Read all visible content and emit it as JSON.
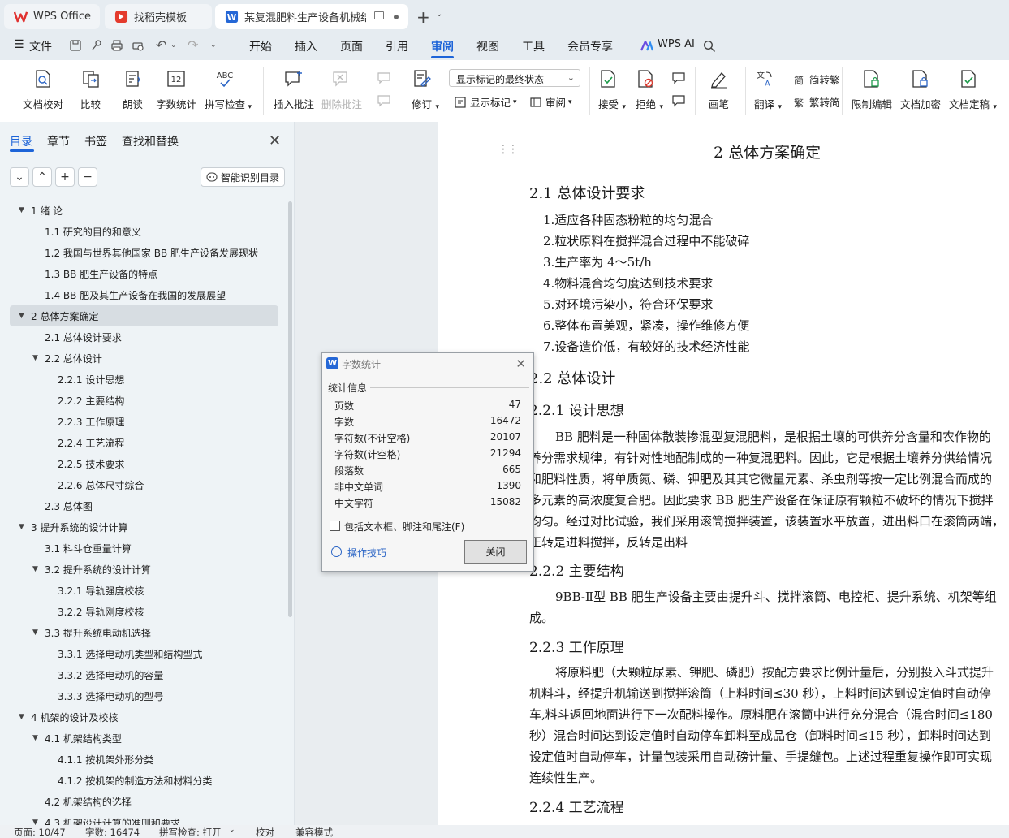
{
  "tabs": [
    {
      "label": "WPS Office",
      "icon": "wps-logo-icon"
    },
    {
      "label": "找稻壳模板",
      "icon": "docer-icon"
    },
    {
      "label": "某复混肥料生产设备机械结构设计",
      "icon": "word-doc-icon"
    }
  ],
  "menu": {
    "file": "文件",
    "items": [
      "开始",
      "插入",
      "页面",
      "引用",
      "审阅",
      "视图",
      "工具",
      "会员专享"
    ],
    "active": "审阅",
    "wps_ai": "WPS AI"
  },
  "ribbon": {
    "doc_proofread": "文档校对",
    "compare": "比较",
    "read_aloud": "朗读",
    "word_count": "字数统计",
    "spell_check": "拼写检查",
    "insert_comment": "插入批注",
    "delete_comment": "删除批注",
    "revise": "修订",
    "markup_dropdown": "显示标记的最终状态",
    "show_markup": "显示标记",
    "review": "审阅",
    "accept": "接受",
    "reject": "拒绝",
    "pen": "画笔",
    "translate": "翻译",
    "to_traditional": "简转繁",
    "to_simplified": "繁转简",
    "restrict_edit": "限制编辑",
    "encrypt": "文档加密",
    "finalize": "文档定稿"
  },
  "nav": {
    "tabs": [
      "目录",
      "章节",
      "书签",
      "查找和替换"
    ],
    "smart_toc": "智能识别目录",
    "toc": [
      {
        "level": 1,
        "text": "1  绪   论",
        "expanded": true
      },
      {
        "level": 2,
        "text": "1.1 研究的目的和意义"
      },
      {
        "level": 2,
        "text": "1.2  我国与世界其他国家 BB 肥生产设备发展现状"
      },
      {
        "level": 2,
        "text": "1.3 BB 肥生产设备的特点"
      },
      {
        "level": 2,
        "text": "1.4 BB 肥及其生产设备在我国的发展展望"
      },
      {
        "level": 1,
        "text": "2  总体方案确定",
        "expanded": true,
        "selected": true
      },
      {
        "level": 2,
        "text": "2.1  总体设计要求"
      },
      {
        "level": 2,
        "text": "2.2  总体设计",
        "expanded": true
      },
      {
        "level": 3,
        "text": "2.2.1  设计思想"
      },
      {
        "level": 3,
        "text": "2.2.2  主要结构"
      },
      {
        "level": 3,
        "text": "2.2.3  工作原理"
      },
      {
        "level": 3,
        "text": "2.2.4  工艺流程"
      },
      {
        "level": 3,
        "text": "2.2.5  技术要求"
      },
      {
        "level": 3,
        "text": "2.2.6  总体尺寸综合"
      },
      {
        "level": 2,
        "text": "2.3  总体图"
      },
      {
        "level": 1,
        "text": "3  提升系统的设计计算",
        "expanded": true
      },
      {
        "level": 2,
        "text": "3.1  料斗仓重量计算"
      },
      {
        "level": 2,
        "text": "3.2  提升系统的设计计算",
        "expanded": true
      },
      {
        "level": 3,
        "text": "3.2.1  导轨强度校核"
      },
      {
        "level": 3,
        "text": "3.2.2  导轨刚度校核"
      },
      {
        "level": 2,
        "text": "3.3  提升系统电动机选择",
        "expanded": true
      },
      {
        "level": 3,
        "text": "3.3.1    选择电动机类型和结构型式"
      },
      {
        "level": 3,
        "text": "3.3.2  选择电动机的容量"
      },
      {
        "level": 3,
        "text": "3.3.3 选择电动机的型号"
      },
      {
        "level": 1,
        "text": "4  机架的设计及校核",
        "expanded": true
      },
      {
        "level": 2,
        "text": "4.1 机架结构类型",
        "expanded": true
      },
      {
        "level": 3,
        "text": "4.1.1  按机架外形分类"
      },
      {
        "level": 3,
        "text": "4.1.2  按机架的制造方法和材料分类"
      },
      {
        "level": 2,
        "text": "4.2  机架结构的选择"
      },
      {
        "level": 2,
        "text": "4.3  机架设计计算的准则和要求",
        "expanded": true
      }
    ]
  },
  "doc": {
    "h1": "2  总体方案确定",
    "s21": "2.1  总体设计要求",
    "reqs": [
      "1.适应各种固态粉粒的均匀混合",
      "2.粒状原料在搅拌混合过程中不能破碎",
      "3.生产率为 4～5t/h",
      "4.物料混合均匀度达到技术要求",
      "5.对环境污染小，符合环保要求",
      "6.整体布置美观，紧凑，操作维修方便",
      "7.设备造价低，有较好的技术经济性能"
    ],
    "s22": "2.2  总体设计",
    "s221": "2.2.1  设计思想",
    "p221": [
      "BB 肥料是一种固体散装掺混型复混肥料，是根据土壤的可供养分含量和农作物的",
      "养分需求规律，有针对性地配制成的一种复混肥料。因此，它是根据土壤养分供给情况",
      "和肥料性质，将单质氮、磷、钾肥及其其它微量元素、杀虫剂等按一定比例混合而成的",
      "多元素的高浓度复合肥。因此要求 BB 肥生产设备在保证原有颗粒不破坏的情况下搅拌",
      "均匀。经过对比试验，我们采用滚筒搅拌装置，该装置水平放置，进出料口在滚筒两端，",
      "正转是进料搅拌，反转是出料"
    ],
    "s222": "2.2.2  主要结构",
    "p222": [
      "9BB-Ⅱ型 BB 肥生产设备主要由提升斗、搅拌滚筒、电控柜、提升系统、机架等组",
      "成。"
    ],
    "s223": "2.2.3  工作原理",
    "p223": [
      "将原料肥（大颗粒尿素、钾肥、磷肥）按配方要求比例计量后，分别投入斗式提升",
      "机料斗，经提升机输送到搅拌滚筒（上料时间≤30 秒），上料时间达到设定值时自动停",
      "车,料斗返回地面进行下一次配料操作。原料肥在滚筒中进行充分混合（混合时间≤180",
      "秒）混合时间达到设定值时自动停车卸料至成品仓（卸料时间≤15 秒），卸料时间达到",
      "设定值时自动停车，计量包装采用自动磅计量、手提缝包。上述过程重复操作即可实现",
      "连续性生产。"
    ],
    "s224": "2.2.4  工艺流程"
  },
  "dialog": {
    "title": "字数统计",
    "section": "统计信息",
    "rows": [
      {
        "label": "页数",
        "value": "47"
      },
      {
        "label": "字数",
        "value": "16472"
      },
      {
        "label": "字符数(不计空格)",
        "value": "20107"
      },
      {
        "label": "字符数(计空格)",
        "value": "21294"
      },
      {
        "label": "段落数",
        "value": "665"
      },
      {
        "label": "非中文单词",
        "value": "1390"
      },
      {
        "label": "中文字符",
        "value": "15082"
      }
    ],
    "checkbox_label": "包括文本框、脚注和尾注(F)",
    "tips": "操作技巧",
    "close_button": "关闭"
  },
  "status": {
    "page": "页面: 10/47",
    "words": "字数: 16474",
    "spell": "拼写检查: 打开",
    "proof": "校对",
    "compat": "兼容模式"
  },
  "colors": {
    "accent": "#1d64d8",
    "nav_bg": "#eef3f6",
    "tabbar_bg": "#e6ecf1"
  }
}
